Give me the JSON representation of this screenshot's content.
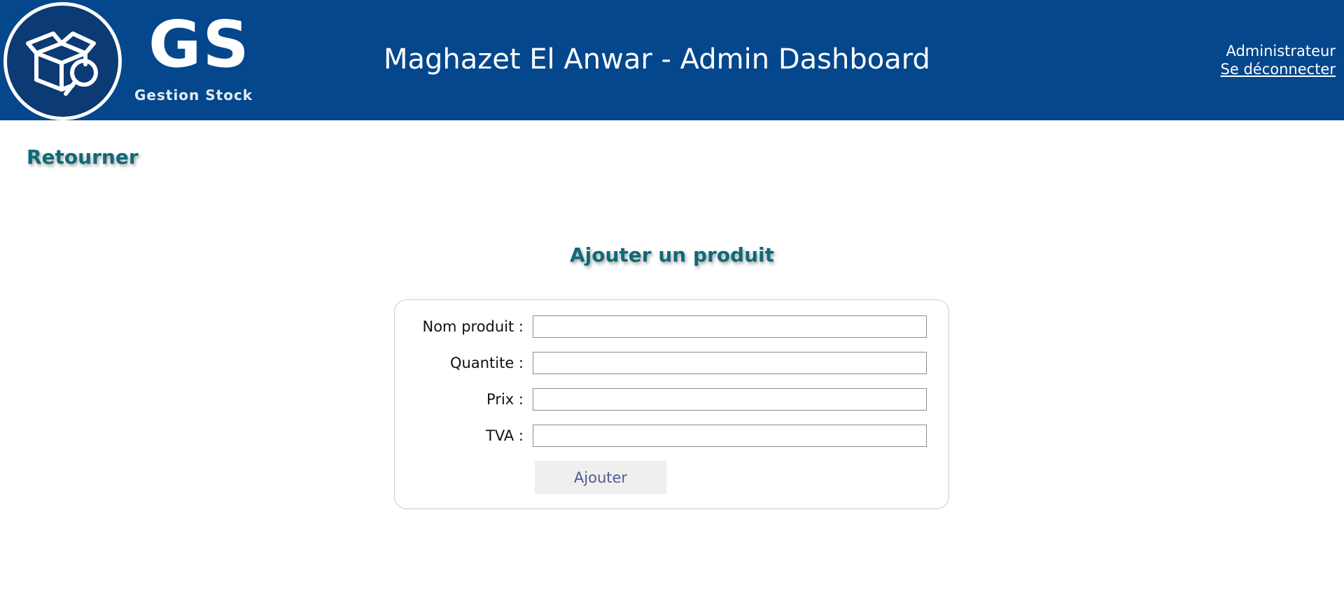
{
  "header": {
    "logo_text": "GS",
    "logo_subtitle": "Gestion Stock",
    "logo_icon": "box-search-icon",
    "title": "Maghazet El Anwar - Admin Dashboard",
    "user_role": "Administrateur",
    "logout_label": "Se déconnecter"
  },
  "nav": {
    "back_label": "Retourner"
  },
  "form": {
    "title": "Ajouter un produit",
    "fields": [
      {
        "label": "Nom produit :",
        "value": "",
        "placeholder": ""
      },
      {
        "label": "Quantite :",
        "value": "",
        "placeholder": ""
      },
      {
        "label": "Prix :",
        "value": "",
        "placeholder": ""
      },
      {
        "label": "TVA :",
        "value": "",
        "placeholder": ""
      }
    ],
    "submit_label": "Ajouter"
  },
  "colors": {
    "header_bg": "#05478c",
    "accent_teal": "#0f6a78",
    "button_text": "#52579a"
  }
}
